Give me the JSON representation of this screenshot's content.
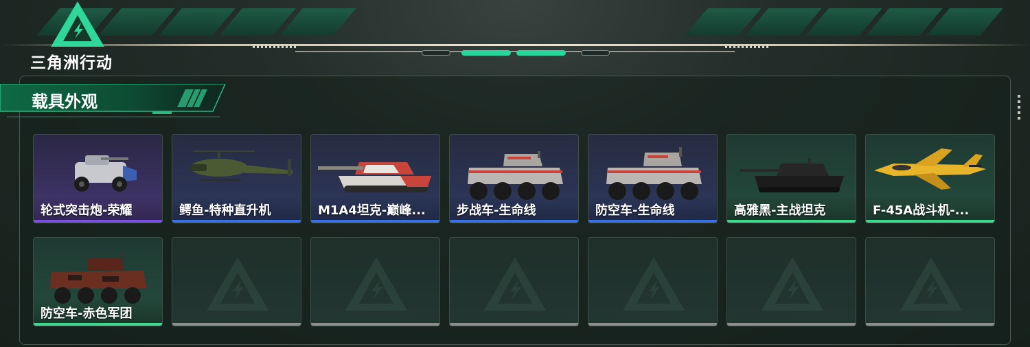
{
  "app": {
    "logo_text": "三角洲行动"
  },
  "section": {
    "title": "载具外观"
  },
  "colors": {
    "accent": "#27d69a",
    "rarity_purple": "#7b4fe0",
    "rarity_blue": "#3a6fe6",
    "rarity_green": "#3ed98f",
    "empty_bar": "#8a8f8c"
  },
  "header_indicators": {
    "count": 4,
    "active": [
      1,
      2
    ]
  },
  "vehicles": [
    {
      "name": "轮式突击炮-荣耀",
      "rarity": "purple",
      "icon": "armored-car-icon"
    },
    {
      "name": "鳄鱼-特种直升机",
      "rarity": "blue",
      "icon": "helicopter-icon"
    },
    {
      "name": "M1A4坦克-巅峰...",
      "rarity": "blue",
      "icon": "tank-icon"
    },
    {
      "name": "步战车-生命线",
      "rarity": "blue",
      "icon": "ifv-icon"
    },
    {
      "name": "防空车-生命线",
      "rarity": "blue",
      "icon": "aa-vehicle-icon"
    },
    {
      "name": "高雅黑-主战坦克",
      "rarity": "green",
      "icon": "tank-icon"
    },
    {
      "name": "F-45A战斗机-...",
      "rarity": "green",
      "icon": "jet-icon"
    },
    {
      "name": "防空车-赤色军团",
      "rarity": "green",
      "icon": "aa-vehicle-icon"
    }
  ],
  "empty_slots": 6
}
